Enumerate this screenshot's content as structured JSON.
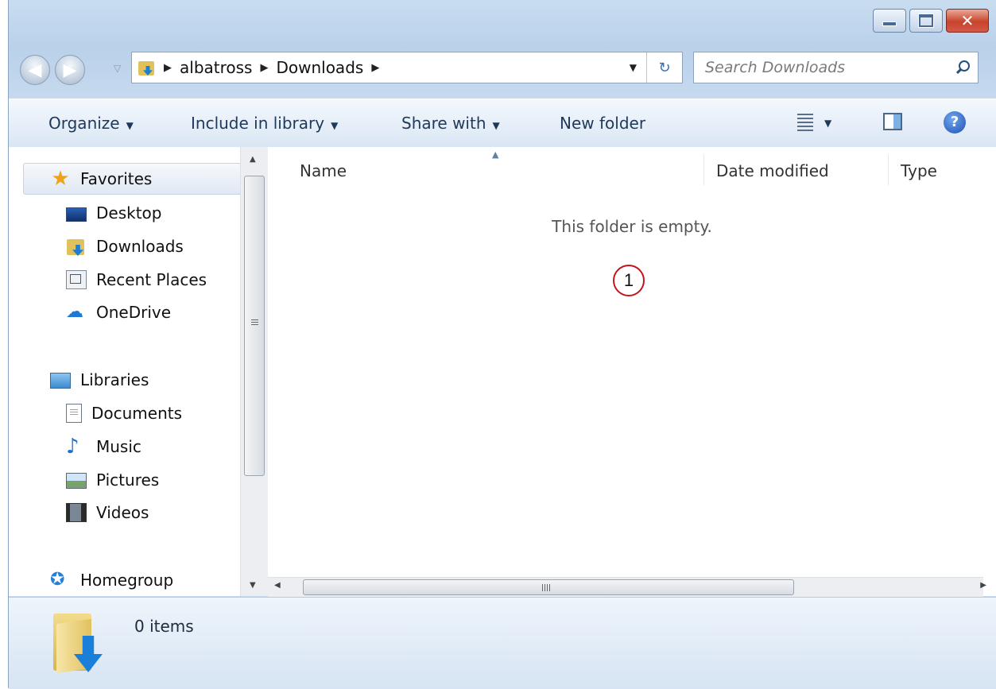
{
  "address": {
    "crumbs": [
      "albatross",
      "Downloads"
    ]
  },
  "search": {
    "placeholder": "Search Downloads"
  },
  "toolbar": {
    "organize": "Organize",
    "include_in_library": "Include in library",
    "share_with": "Share with",
    "new_folder": "New folder"
  },
  "nav": {
    "favorites": "Favorites",
    "favorites_items": [
      "Desktop",
      "Downloads",
      "Recent Places",
      "OneDrive"
    ],
    "libraries": "Libraries",
    "libraries_items": [
      "Documents",
      "Music",
      "Pictures",
      "Videos"
    ],
    "homegroup": "Homegroup"
  },
  "columns": [
    "Name",
    "Date modified",
    "Type"
  ],
  "content": {
    "empty_message": "This folder is empty.",
    "marker": "1"
  },
  "status": {
    "items": "0 items"
  },
  "icons": {
    "back": "back-arrow-icon",
    "forward": "forward-arrow-icon",
    "refresh": "refresh-icon",
    "search": "search-icon",
    "help": "help-icon"
  }
}
